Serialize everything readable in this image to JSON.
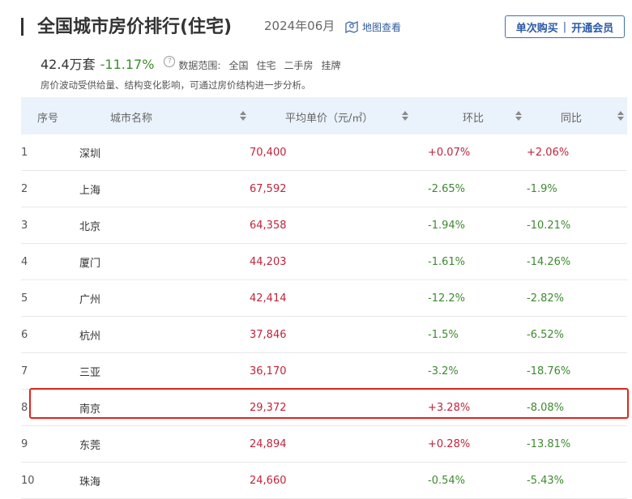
{
  "header": {
    "title": "全国城市房价排行(住宅)",
    "date": "2024年06月",
    "map_link_label": "地图查看",
    "buy_once_label": "单次购买",
    "separator": "|",
    "membership_label": "开通会员"
  },
  "stats": {
    "volume": "42.4万套",
    "change": "-11.17%",
    "scope_label": "数据范围:",
    "scope_items": [
      "全国",
      "住宅",
      "二手房",
      "挂牌"
    ]
  },
  "note": "房价波动受供给量、结构变化影响，可通过房价结构进一步分析。",
  "table": {
    "headers": {
      "index": "序号",
      "city": "城市名称",
      "price": "平均单价（元/㎡）",
      "mom": "环比",
      "yoy": "同比"
    },
    "rows": [
      {
        "index": "1",
        "city": "深圳",
        "price": "70,400",
        "mom": "+0.07%",
        "yoy": "+2.06%"
      },
      {
        "index": "2",
        "city": "上海",
        "price": "67,592",
        "mom": "-2.65%",
        "yoy": "-1.9%"
      },
      {
        "index": "3",
        "city": "北京",
        "price": "64,358",
        "mom": "-1.94%",
        "yoy": "-10.21%"
      },
      {
        "index": "4",
        "city": "厦门",
        "price": "44,203",
        "mom": "-1.61%",
        "yoy": "-14.26%"
      },
      {
        "index": "5",
        "city": "广州",
        "price": "42,414",
        "mom": "-12.2%",
        "yoy": "-2.82%"
      },
      {
        "index": "6",
        "city": "杭州",
        "price": "37,846",
        "mom": "-1.5%",
        "yoy": "-6.52%"
      },
      {
        "index": "7",
        "city": "三亚",
        "price": "36,170",
        "mom": "-3.2%",
        "yoy": "-18.76%"
      },
      {
        "index": "8",
        "city": "南京",
        "price": "29,372",
        "mom": "+3.28%",
        "yoy": "-8.08%"
      },
      {
        "index": "9",
        "city": "东莞",
        "price": "24,894",
        "mom": "+0.28%",
        "yoy": "-13.81%"
      },
      {
        "index": "10",
        "city": "珠海",
        "price": "24,660",
        "mom": "-0.54%",
        "yoy": "-5.43%"
      }
    ],
    "highlighted_row_index": "8"
  },
  "colors": {
    "up": "#c0243b",
    "down": "#3e8a30",
    "header_bg": "#eaf2fb",
    "accent": "#2a5aa8",
    "highlight_border": "#e0241b"
  },
  "icons": {
    "map": "map-pin-icon",
    "sort": "sort-icon",
    "help": "question-circle-icon"
  }
}
